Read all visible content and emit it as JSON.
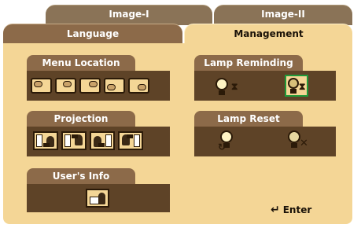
{
  "tabs": {
    "image1": "Image-I",
    "image2": "Image-II",
    "language": "Language",
    "management": "Management"
  },
  "groups": {
    "menu_location": {
      "title": "Menu Location",
      "icons": [
        "menu-top-left-icon",
        "menu-top-center-icon",
        "menu-top-right-icon",
        "menu-bottom-left-icon",
        "menu-bottom-right-icon"
      ]
    },
    "projection": {
      "title": "Projection",
      "icons": [
        "front-desktop-icon",
        "front-ceiling-icon",
        "rear-desktop-icon",
        "rear-ceiling-icon"
      ]
    },
    "users_info": {
      "title": "User's Info",
      "icons": [
        "user-info-icon"
      ]
    },
    "lamp_reminding": {
      "title": "Lamp Reminding",
      "icons": [
        "lamp-reminder-off-icon",
        "lamp-reminder-on-icon"
      ],
      "selected": "lamp-reminder-on-icon"
    },
    "lamp_reset": {
      "title": "Lamp Reset",
      "icons": [
        "lamp-reset-yes-icon",
        "lamp-reset-no-icon"
      ]
    }
  },
  "footer": {
    "enter_label": "Enter"
  },
  "colors": {
    "panel": "#f4d696",
    "group_header": "#8c6a49",
    "group_body": "#5e4327",
    "selection": "#1f9a3a"
  }
}
